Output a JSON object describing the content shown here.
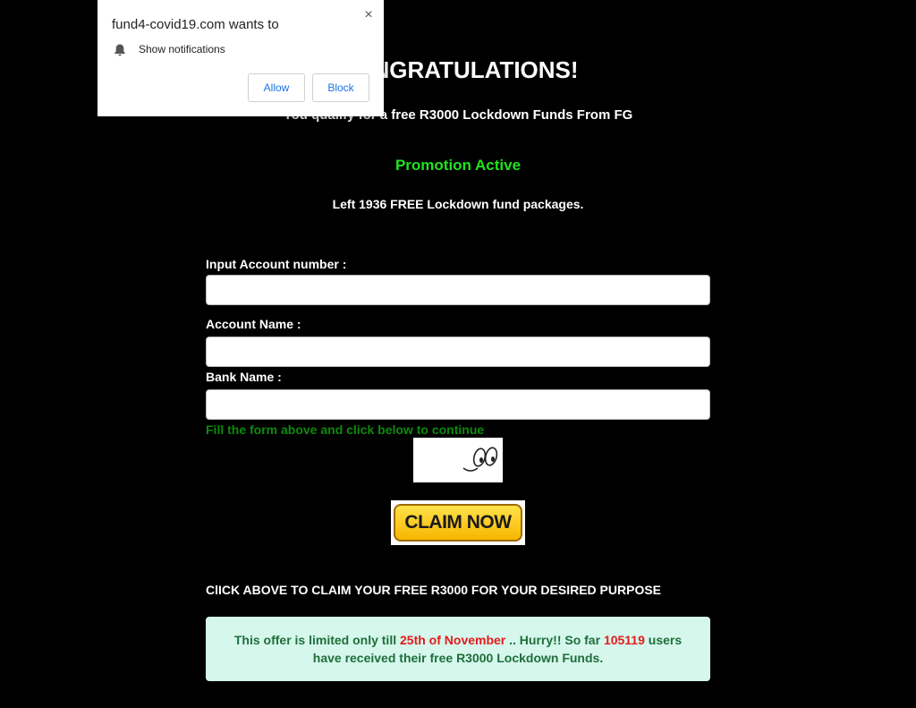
{
  "page": {
    "headline": "CONGRATULATIONS!",
    "subline": "You qualify for a free R3000 Lockdown Funds From FG",
    "promo": "Promotion Active",
    "left_count": "Left 1936 FREE Lockdown fund packages."
  },
  "form": {
    "account_number_label": "Input Account number :",
    "account_name_label": "Account Name :",
    "bank_name_label": "Bank Name :",
    "account_number_value": "",
    "account_name_value": "",
    "bank_name_value": "",
    "fill_note": "Fill the form above and click below to continue"
  },
  "claim": {
    "button_label": "CLAIM NOW",
    "note": "ClICK ABOVE TO CLAIM YOUR FREE R3000 FOR YOUR DESIRED PURPOSE"
  },
  "offer": {
    "part1": "This offer is limited only till ",
    "date": "25th of November",
    "part2": " .. Hurry!! So far ",
    "count": "105119",
    "part3": " users have received their free R3000 Lockdown Funds."
  },
  "notification": {
    "title": "fund4-covid19.com wants to",
    "permission": "Show notifications",
    "allow_label": "Allow",
    "block_label": "Block",
    "close_icon": "×"
  },
  "colors": {
    "background": "#000000",
    "promo_green": "#1fe21f",
    "note_green": "#0c8a0c",
    "highlight_red": "#e51a1a",
    "offer_bg": "#d5f7ec",
    "link_blue": "#1a73e8"
  },
  "icons": [
    "bell-icon",
    "close-icon",
    "cartoon-eyes-icon"
  ]
}
